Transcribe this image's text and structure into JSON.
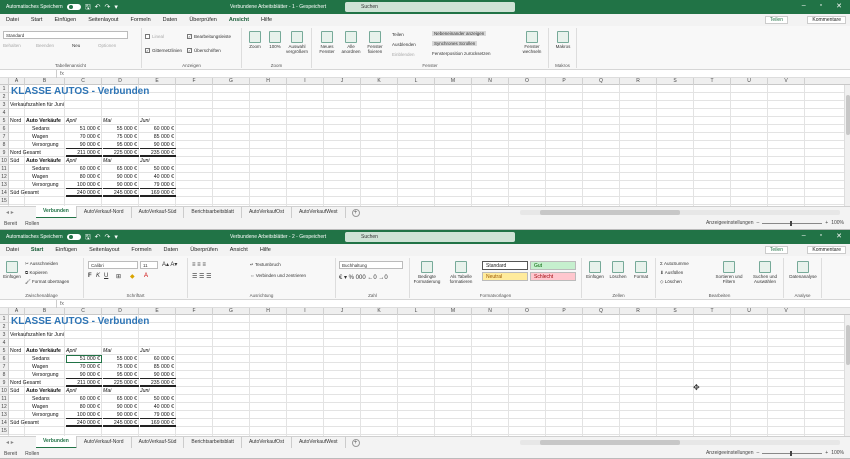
{
  "w1": {
    "autosave": "Automatisches Speichern",
    "doc_title": "Verbundene Arbeitsblätter - 1 - Gespeichert",
    "search": "Suchen",
    "menu": [
      "Datei",
      "Start",
      "Einfügen",
      "Seitenlayout",
      "Formeln",
      "Daten",
      "Überprüfen",
      "Ansicht",
      "Hilfe"
    ],
    "active_menu": "Ansicht",
    "share": "Teilen",
    "comments": "Kommentare",
    "ribbon": {
      "view_select": "Standard",
      "behalten": "Behalten",
      "beenden": "Beenden",
      "neu": "Neu",
      "optionen": "Optionen",
      "g1_label": "Tabellenansicht",
      "lineal": "Lineal",
      "bearbeitungsleiste": "Bearbeitungsleiste",
      "gitternetzlinien": "Gitternetzlinien",
      "ueberschriften": "Überschriften",
      "g2_label": "Anzeigen",
      "zoom": "Zoom",
      "zoom100": "100%",
      "auswahl": "Auswahl vergrößern",
      "g3_label": "Zoom",
      "neues_fenster": "Neues Fenster",
      "alle_anordnen": "Alle anordnen",
      "fenster_fixieren": "Fenster fixieren",
      "teilen": "Teilen",
      "ausblenden": "Ausblenden",
      "einblenden": "Einblenden",
      "nebeneinander": "Nebeneinander anzeigen",
      "synchrones": "Synchrones Scrollen",
      "fensterposition": "Fensterposition zurücksetzen",
      "fenster_wechseln": "Fenster wechseln",
      "g4_label": "Fenster",
      "makros": "Makros",
      "g5_label": "Makros"
    },
    "status": "Bereit",
    "status2": "Rollen",
    "display_settings": "Anzeigeeinstellungen",
    "zoom_value": "100%"
  },
  "w2": {
    "autosave": "Automatisches Speichern",
    "doc_title": "Verbundene Arbeitsblätter - 2 - Gespeichert",
    "search": "Suchen",
    "menu": [
      "Datei",
      "Start",
      "Einfügen",
      "Seitenlayout",
      "Formeln",
      "Daten",
      "Überprüfen",
      "Ansicht",
      "Hilfe"
    ],
    "active_menu": "Start",
    "share": "Teilen",
    "comments": "Kommentare",
    "ribbon": {
      "einfuegen": "Einfügen",
      "ausschneiden": "Ausschneiden",
      "kopieren": "Kopieren",
      "format_uebertragen": "Format übertragen",
      "g1_label": "Zwischenablage",
      "font": "Calibri",
      "font_size": "11",
      "g2_label": "Schriftart",
      "textumbruch": "Textumbruch",
      "verbinden": "Verbinden und zentrieren",
      "g3_label": "Ausrichtung",
      "number_format": "Buchhaltung",
      "g4_label": "Zahl",
      "bedingte": "Bedingte Formatierung",
      "als_tabelle": "Als Tabelle formatieren",
      "style_standard": "Standard",
      "style_gut": "Gut",
      "style_neutral": "Neutral",
      "style_schlecht": "Schlecht",
      "g5_label": "Formatvorlagen",
      "z_einfuegen": "Einfügen",
      "z_loeschen": "Löschen",
      "z_format": "Format",
      "g6_label": "Zellen",
      "autosumme": "AutoSumme",
      "ausfuellen": "Ausfüllen",
      "loeschen": "Löschen",
      "sortieren": "Sortieren und Filtern",
      "suchen": "Suchen und Auswählen",
      "g7_label": "Bearbeiten",
      "datenanalyse": "Datenanalyse",
      "g8_label": "Analyse"
    },
    "status": "Bereit",
    "status2": "Rollen",
    "display_settings": "Anzeigeeinstellungen",
    "zoom_value": "100%"
  },
  "sheet": {
    "columns": [
      "A",
      "B",
      "C",
      "D",
      "E",
      "F",
      "G",
      "H",
      "I",
      "J",
      "K",
      "L",
      "M",
      "N",
      "O",
      "P",
      "Q",
      "R",
      "S",
      "T",
      "U",
      "V"
    ],
    "title": "KLASSE AUTOS - Verbunden",
    "subtitle": "Verkaufszahlen für Juni",
    "nord": "Nord",
    "sued": "Süd",
    "header_label": "Auto Verkäufe",
    "months": [
      "April",
      "Mai",
      "Juni"
    ],
    "nord_rows": [
      {
        "label": "Sedans",
        "values": [
          "51 000 €",
          "55 000 €",
          "60 000 €"
        ]
      },
      {
        "label": "Wagen",
        "values": [
          "70 000 €",
          "75 000 €",
          "85 000 €"
        ]
      },
      {
        "label": "Versorgung",
        "values": [
          "90 000 €",
          "95 000 €",
          "90 000 €"
        ]
      }
    ],
    "nord_total_label": "Nord Gesamt",
    "nord_total": [
      "211 000 €",
      "225 000 €",
      "235 000 €"
    ],
    "sued_rows": [
      {
        "label": "Sedans",
        "values": [
          "60 000 €",
          "65 000 €",
          "50 000 €"
        ]
      },
      {
        "label": "Wagen",
        "values": [
          "80 000 €",
          "90 000 €",
          "40 000 €"
        ]
      },
      {
        "label": "Versorgung",
        "values": [
          "100 000 €",
          "90 000 €",
          "79 000 €"
        ]
      }
    ],
    "sued_total_label": "Süd Gesamt",
    "sued_total": [
      "240 000 €",
      "245 000 €",
      "169 000 €"
    ],
    "tabs": [
      "Verbunden",
      "AutoVerkauf-Nord",
      "AutoVerkauf-Süd",
      "Berichtsarbeitsblatt",
      "AutoVerkaufOst",
      "AutoVerkaufWest"
    ],
    "active_tab": "Verbunden"
  }
}
